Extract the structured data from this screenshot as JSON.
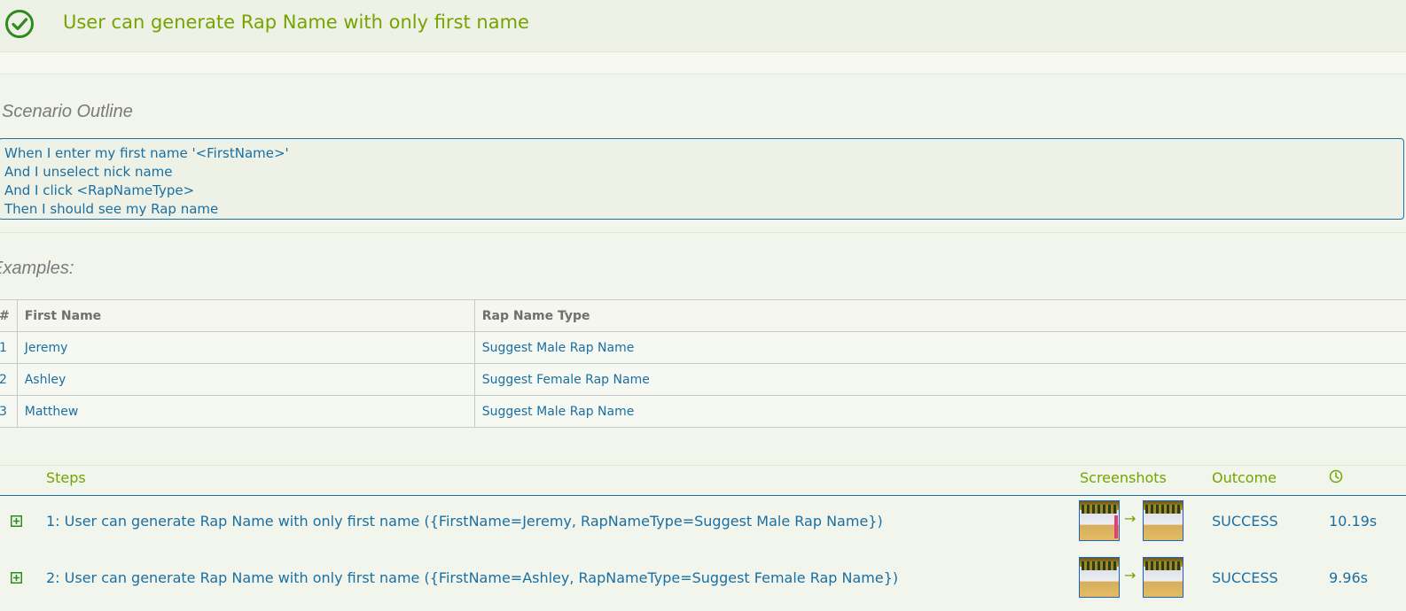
{
  "header": {
    "title": "User can generate Rap Name with only first name",
    "status_icon": "check-circle-icon"
  },
  "outline": {
    "heading": "Scenario Outline",
    "steps": [
      "When I enter my first name '<FirstName>'",
      "And I unselect nick name",
      "And I click <RapNameType>",
      "Then I should see my Rap name"
    ]
  },
  "examples": {
    "heading": "Examples:",
    "columns": [
      "#",
      "First Name",
      "Rap Name Type"
    ],
    "rows": [
      [
        "1",
        "Jeremy",
        "Suggest Male Rap Name"
      ],
      [
        "2",
        "Ashley",
        "Suggest Female Rap Name"
      ],
      [
        "3",
        "Matthew",
        "Suggest Male Rap Name"
      ]
    ]
  },
  "steps_table": {
    "headers": {
      "steps": "Steps",
      "screenshots": "Screenshots",
      "outcome": "Outcome",
      "duration_icon": "clock-icon"
    },
    "rows": [
      {
        "text": "1: User can generate Rap Name with only first name ({FirstName=Jeremy, RapNameType=Suggest Male Rap Name})",
        "outcome": "SUCCESS",
        "duration": "10.19s"
      },
      {
        "text": "2: User can generate Rap Name with only first name ({FirstName=Ashley, RapNameType=Suggest Female Rap Name})",
        "outcome": "SUCCESS",
        "duration": "9.96s"
      }
    ]
  },
  "colors": {
    "accent_green": "#75a300",
    "link_blue": "#1a6fa3",
    "background": "#f2f5ec"
  }
}
